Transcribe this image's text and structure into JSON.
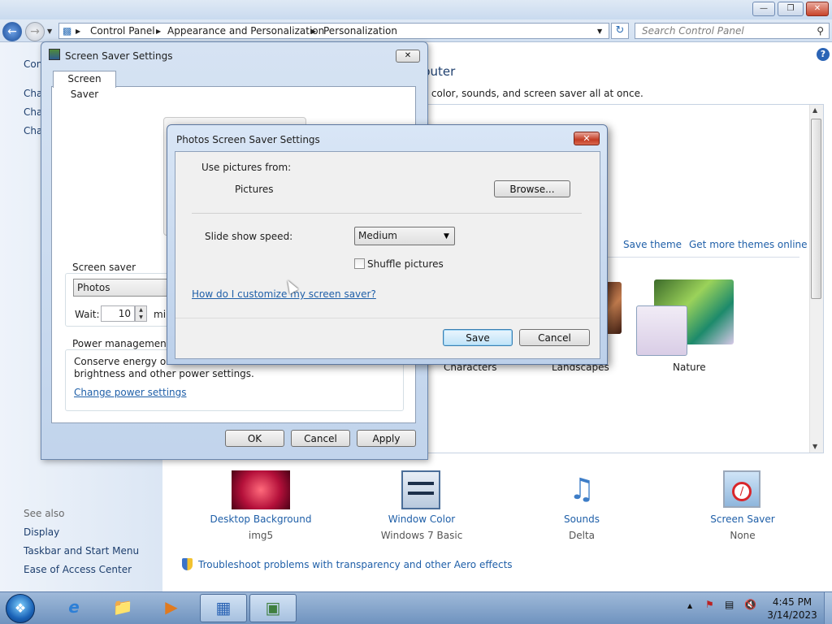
{
  "window": {
    "minimize_icon": "minimize-icon",
    "maximize_icon": "restore-icon",
    "close_icon": "close-icon"
  },
  "address": {
    "crumbs": [
      "Control Panel",
      "Appearance and Personalization",
      "Personalization"
    ],
    "search_placeholder": "Search Control Panel"
  },
  "left_pane": {
    "cut_items": [
      "Con",
      "Cha",
      "Cha",
      "Cha"
    ],
    "see_also_title": "See also",
    "see_also": [
      "Display",
      "Taskbar and Start Menu",
      "Ease of Access Center"
    ]
  },
  "main": {
    "heading_fragment": "puter",
    "description_fragment": "v color, sounds, and screen saver all at once.",
    "save_theme": "Save theme",
    "get_more_themes": "Get more themes online",
    "themes": [
      "Characters",
      "Landscapes",
      "Nature"
    ],
    "bottom_items": [
      {
        "label": "Desktop Background",
        "sub": "img5"
      },
      {
        "label": "Window Color",
        "sub": "Windows 7 Basic"
      },
      {
        "label": "Sounds",
        "sub": "Delta"
      },
      {
        "label": "Screen Saver",
        "sub": "None"
      }
    ],
    "troubleshoot": "Troubleshoot problems with transparency and other Aero effects"
  },
  "screen_saver_dialog": {
    "title": "Screen Saver Settings",
    "tab": "Screen Saver",
    "group_label": "Screen saver",
    "selected": "Photos",
    "wait_label": "Wait:",
    "wait_value": "10",
    "wait_unit_fragment": "mi",
    "power_group": "Power management",
    "power_text_1": "Conserve energy or m",
    "power_text_2": "brightness and other power settings.",
    "power_link": "Change power settings",
    "ok": "OK",
    "cancel": "Cancel",
    "apply": "Apply"
  },
  "photos_dialog": {
    "title": "Photos Screen Saver Settings",
    "use_pictures_label": "Use pictures from:",
    "folder": "Pictures",
    "browse": "Browse...",
    "speed_label": "Slide show speed:",
    "speed_value": "Medium",
    "shuffle_label": "Shuffle pictures",
    "shuffle_checked": false,
    "help_link": "How do I customize my screen saver?",
    "save": "Save",
    "cancel": "Cancel"
  },
  "taskbar": {
    "time": "4:45 PM",
    "date": "3/14/2023"
  }
}
